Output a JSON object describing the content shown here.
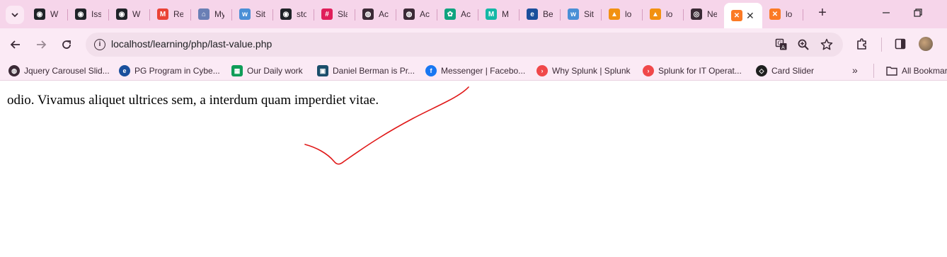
{
  "tabs": [
    {
      "label": "W",
      "icon": "github-icon",
      "color": "#1f2328"
    },
    {
      "label": "Iss",
      "icon": "github-icon",
      "color": "#1f2328"
    },
    {
      "label": "W",
      "icon": "github-icon",
      "color": "#1f2328"
    },
    {
      "label": "Re",
      "icon": "gmail-icon",
      "color": "#ea4335"
    },
    {
      "label": "My",
      "icon": "portal-icon",
      "color": "#6a7fb5"
    },
    {
      "label": "Sit",
      "icon": "webo-icon",
      "color": "#4a8fd6"
    },
    {
      "label": "sto",
      "icon": "github-icon",
      "color": "#1f2328"
    },
    {
      "label": "Sla",
      "icon": "slack-icon",
      "color": "#e01e5a"
    },
    {
      "label": "Ac",
      "icon": "globe-icon",
      "color": "#3b2a36"
    },
    {
      "label": "Ac",
      "icon": "globe-icon",
      "color": "#3b2a36"
    },
    {
      "label": "Ac",
      "icon": "chatgpt-icon",
      "color": "#10a37f"
    },
    {
      "label": "M",
      "icon": "m-logo-icon",
      "color": "#14b8a6"
    },
    {
      "label": "Be",
      "icon": "edureka-icon",
      "color": "#1a4f9c"
    },
    {
      "label": "Sit",
      "icon": "webo-icon",
      "color": "#4a8fd6"
    },
    {
      "label": "lo",
      "icon": "phpmyadmin-icon",
      "color": "#f29111"
    },
    {
      "label": "lo",
      "icon": "phpmyadmin-icon",
      "color": "#f29111"
    },
    {
      "label": "Ne",
      "icon": "chrome-icon",
      "color": "#3b2a36"
    },
    {
      "label": "",
      "icon": "xampp-icon",
      "color": "#fb7a24",
      "active": true
    },
    {
      "label": "lo",
      "icon": "xampp-icon",
      "color": "#fb7a24"
    }
  ],
  "toolbar": {
    "url": "localhost/learning/php/last-value.php"
  },
  "bookmarks": [
    {
      "label": "Jquery Carousel Slid...",
      "icon": "globe-icon",
      "color": "#3b2a36"
    },
    {
      "label": "PG Program in Cybe...",
      "icon": "edureka-icon",
      "color": "#1a4f9c"
    },
    {
      "label": "Our Daily work",
      "icon": "sheets-icon",
      "color": "#0f9d58"
    },
    {
      "label": "Daniel Berman is Pr...",
      "icon": "logzio-icon",
      "color": "#1b4e6b"
    },
    {
      "label": "Messenger | Facebo...",
      "icon": "facebook-icon",
      "color": "#1877f2"
    },
    {
      "label": "Why Splunk | Splunk",
      "icon": "splunk-icon",
      "color": "#f0484a"
    },
    {
      "label": "Splunk for IT Operat...",
      "icon": "splunk-icon",
      "color": "#f0484a"
    },
    {
      "label": "Card Slider",
      "icon": "codepen-icon",
      "color": "#1f1f1f"
    }
  ],
  "all_bookmarks_label": "All Bookmarks",
  "content": {
    "text": "odio. Vivamus aliquet ultrices sem, a interdum quam imperdiet vitae."
  },
  "annotation_color": "#e01818"
}
